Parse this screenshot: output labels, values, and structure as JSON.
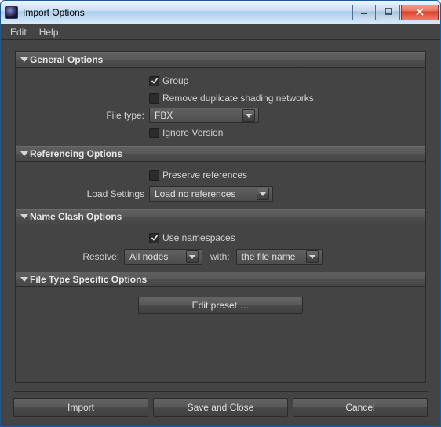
{
  "window": {
    "title": "Import Options"
  },
  "menubar": {
    "edit": "Edit",
    "help": "Help"
  },
  "sections": {
    "general": {
      "title": "General Options",
      "group_label": "Group",
      "group_checked": true,
      "remove_dup_label": "Remove duplicate shading networks",
      "remove_dup_checked": false,
      "file_type_label": "File type:",
      "file_type_value": "FBX",
      "ignore_version_label": "Ignore Version",
      "ignore_version_checked": false
    },
    "referencing": {
      "title": "Referencing Options",
      "preserve_label": "Preserve references",
      "preserve_checked": false,
      "load_settings_label": "Load Settings",
      "load_settings_value": "Load no references"
    },
    "nameclash": {
      "title": "Name Clash Options",
      "use_namespaces_label": "Use namespaces",
      "use_namespaces_checked": true,
      "resolve_label": "Resolve:",
      "resolve_value": "All nodes",
      "with_label": "with:",
      "with_value": "the file name"
    },
    "filetype": {
      "title": "File Type Specific Options",
      "edit_preset_label": "Edit preset …"
    }
  },
  "footer": {
    "import": "Import",
    "save_close": "Save and Close",
    "cancel": "Cancel"
  }
}
